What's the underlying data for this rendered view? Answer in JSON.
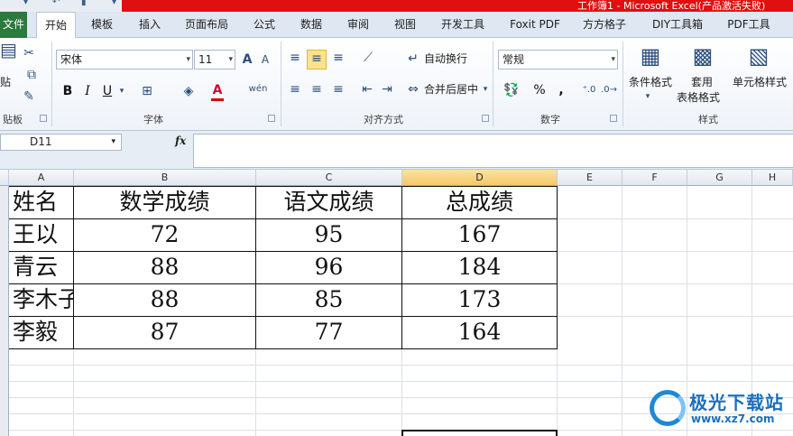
{
  "window": {
    "title": "工作簿1 - Microsoft Excel(产品激活失败)"
  },
  "tabs": [
    {
      "label": "文件"
    },
    {
      "label": "开始"
    },
    {
      "label": "模板"
    },
    {
      "label": "插入"
    },
    {
      "label": "页面布局"
    },
    {
      "label": "公式"
    },
    {
      "label": "数据"
    },
    {
      "label": "审阅"
    },
    {
      "label": "视图"
    },
    {
      "label": "开发工具"
    },
    {
      "label": "Foxit PDF"
    },
    {
      "label": "方方格子"
    },
    {
      "label": "DIY工具箱"
    },
    {
      "label": "PDF工具"
    }
  ],
  "ribbon": {
    "clipboard": {
      "label": "贴板",
      "paste": "贴"
    },
    "font": {
      "label": "字体",
      "name": "宋体",
      "size": "11",
      "bold": "B",
      "italic": "I",
      "underline": "U",
      "font_color": "A",
      "pinyin": "wén"
    },
    "alignment": {
      "label": "对齐方式",
      "wrap_text": "自动换行",
      "merge_center": "合并后居中"
    },
    "number": {
      "label": "数字",
      "format": "常规",
      "percent": "%",
      "comma": ","
    },
    "styles": {
      "label": "样式",
      "conditional": "条件格式",
      "table_line1": "套用",
      "table_line2": "表格格式",
      "cell_styles": "单元格样式"
    }
  },
  "formula_bar": {
    "name_box": "D11",
    "fx": "fx",
    "value": ""
  },
  "grid": {
    "columns": [
      "A",
      "B",
      "C",
      "D",
      "E",
      "F",
      "G",
      "H"
    ],
    "selected_column": "D",
    "headers": [
      "姓名",
      "数学成绩",
      "语文成绩",
      "总成绩"
    ],
    "rows": [
      [
        "王以",
        "72",
        "95",
        "167"
      ],
      [
        "青云",
        "88",
        "96",
        "184"
      ],
      [
        "李木子",
        "88",
        "85",
        "173"
      ],
      [
        "李毅",
        "87",
        "77",
        "164"
      ]
    ]
  },
  "watermark": {
    "name": "极光下载站",
    "url": "www.xz7.com"
  },
  "colors": {
    "file_tab": "#2b7a3e",
    "title_bar": "#e01010",
    "selected_header": "#f5c86a",
    "accent_blue": "#1d6fb8"
  }
}
